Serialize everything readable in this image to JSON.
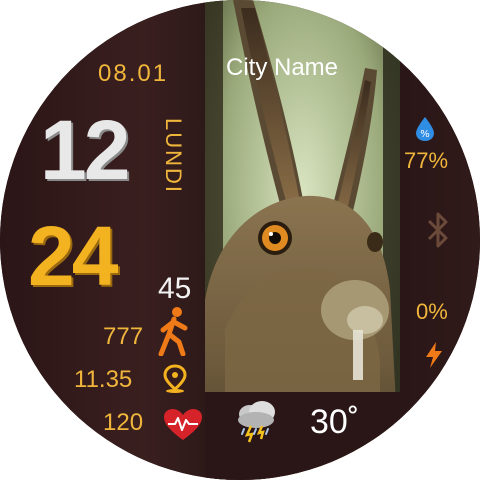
{
  "watch": {
    "date": "08.01",
    "hour": "12",
    "minute": "24",
    "seconds": "45",
    "day_name": "LUNDI",
    "city": "City Name",
    "steps": "777",
    "distance": "11.35",
    "heart_rate": "120",
    "temperature": "30˚",
    "humidity": "77%",
    "battery": "0%"
  },
  "icons": {
    "steps": "walking-person-icon",
    "distance": "location-pin-icon",
    "heart": "heart-rate-icon",
    "weather": "thunderstorm-icon",
    "humidity": "water-drop-icon",
    "bluetooth": "bluetooth-icon",
    "battery": "lightning-bolt-icon"
  },
  "colors": {
    "accent": "#f0b63c",
    "minute": "#f3b21f",
    "hour": "#e8e8e8",
    "icon_orange": "#f07a18",
    "heart": "#d6232a",
    "background": "#2a1617"
  }
}
